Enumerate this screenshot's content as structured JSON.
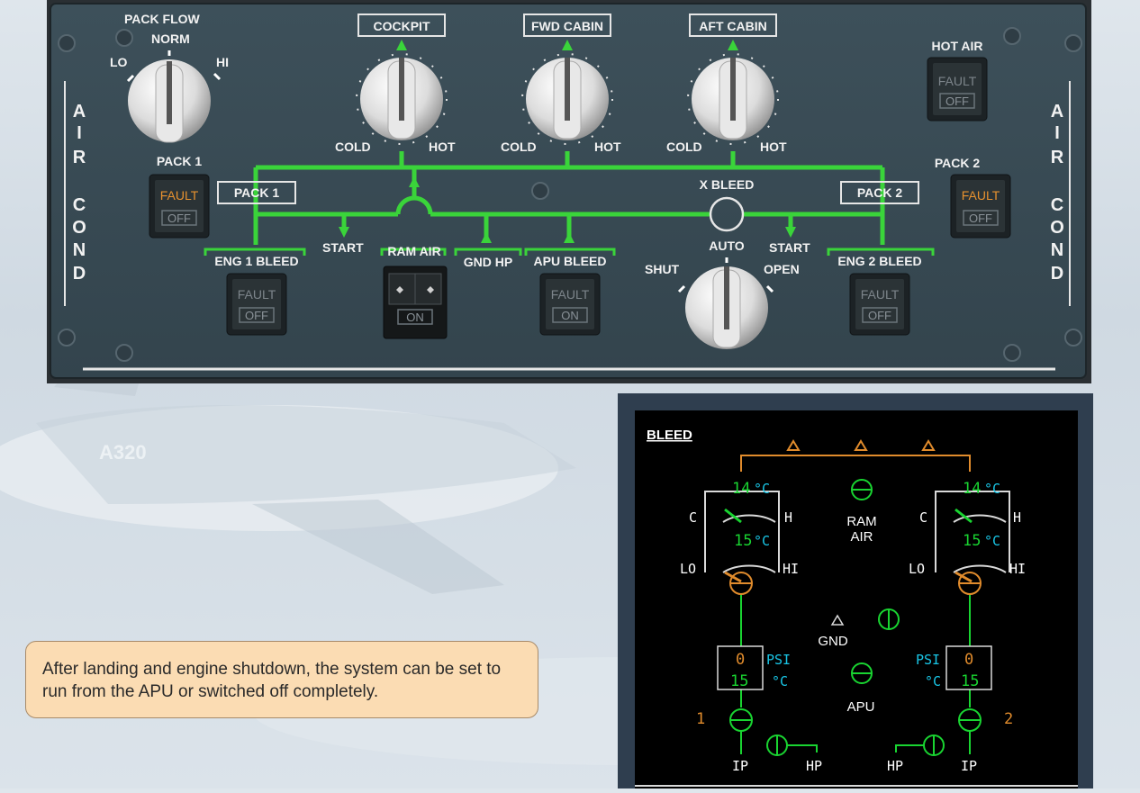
{
  "panel": {
    "side_label_left": [
      "A",
      "I",
      "R",
      "",
      "C",
      "O",
      "N",
      "D"
    ],
    "side_label_right": [
      "A",
      "I",
      "R",
      "",
      "C",
      "O",
      "N",
      "D"
    ],
    "pack_flow": {
      "title": "PACK FLOW",
      "norm": "NORM",
      "lo": "LO",
      "hi": "HI"
    },
    "temp_selectors": [
      {
        "label": "COCKPIT",
        "cold": "COLD",
        "hot": "HOT"
      },
      {
        "label": "FWD CABIN",
        "cold": "COLD",
        "hot": "HOT"
      },
      {
        "label": "AFT CABIN",
        "cold": "COLD",
        "hot": "HOT"
      }
    ],
    "hot_air": {
      "title": "HOT AIR",
      "fault": "FAULT",
      "state": "OFF"
    },
    "pack1_button": {
      "title": "PACK 1",
      "fault": "FAULT",
      "state": "OFF"
    },
    "pack2_button": {
      "title": "PACK 2",
      "fault": "FAULT",
      "state": "OFF"
    },
    "pack1_box": "PACK 1",
    "pack2_box": "PACK 2",
    "x_bleed": {
      "title": "X BLEED",
      "auto": "AUTO",
      "shut": "SHUT",
      "open": "OPEN"
    },
    "start_left": "START",
    "start_right": "START",
    "ram_air": {
      "title": "RAM AIR",
      "state": "ON"
    },
    "gnd_hp": "GND HP",
    "apu_bleed": {
      "title": "APU BLEED",
      "fault": "FAULT",
      "state": "ON"
    },
    "eng1_bleed": {
      "title": "ENG 1 BLEED",
      "fault": "FAULT",
      "state": "OFF"
    },
    "eng2_bleed": {
      "title": "ENG 2 BLEED",
      "fault": "FAULT",
      "state": "OFF"
    }
  },
  "info_text": "After landing and engine shutdown, the system can be set to run from the APU or switched off completely.",
  "ecam": {
    "title": "BLEED",
    "left": {
      "outlet_temp": "14",
      "unit": "°C",
      "c": "C",
      "h": "H",
      "flow_temp": "15",
      "lo": "LO",
      "hi": "HI",
      "psi": "0",
      "psi_unit": "PSI",
      "precooler_temp": "15",
      "temp_unit": "°C",
      "engine": "1",
      "ip": "IP",
      "hp": "HP"
    },
    "right": {
      "outlet_temp": "14",
      "unit": "°C",
      "c": "C",
      "h": "H",
      "flow_temp": "15",
      "lo": "LO",
      "hi": "HI",
      "psi": "0",
      "psi_unit": "PSI",
      "precooler_temp": "15",
      "temp_unit": "°C",
      "engine": "2",
      "ip": "IP",
      "hp": "HP"
    },
    "ram_air": "RAM AIR",
    "gnd": "GND",
    "apu": "APU"
  },
  "colors": {
    "panel": "#36474f",
    "line_green": "#3ad43a",
    "fault_amber": "#e8922f",
    "ecam_green": "#19d431",
    "ecam_cyan": "#19c6e6",
    "ecam_amber": "#e08b2c",
    "info_bg": "#fbdcb3"
  }
}
